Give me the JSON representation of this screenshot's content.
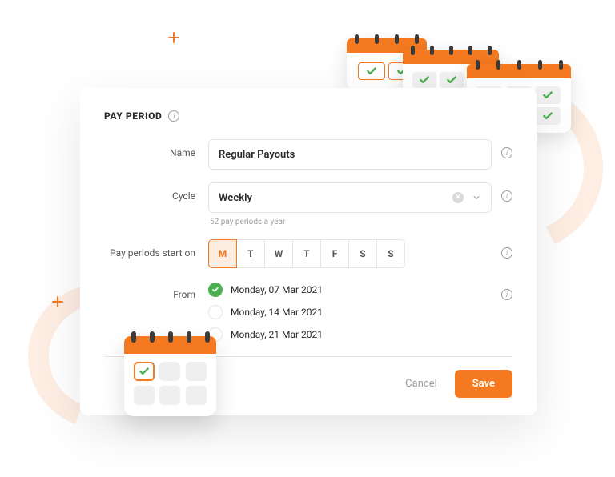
{
  "section_title": "PAY PERIOD",
  "fields": {
    "name": {
      "label": "Name",
      "value": "Regular Payouts"
    },
    "cycle": {
      "label": "Cycle",
      "value": "Weekly",
      "hint": "52 pay periods a year"
    },
    "start_day": {
      "label": "Pay periods start on",
      "days": [
        "M",
        "T",
        "W",
        "T",
        "F",
        "S",
        "S"
      ],
      "selected_index": 0
    },
    "from": {
      "label": "From",
      "options": [
        "Monday, 07 Mar 2021",
        "Monday, 14 Mar 2021",
        "Monday, 21 Mar 2021"
      ],
      "selected_index": 0
    }
  },
  "actions": {
    "cancel": "Cancel",
    "save": "Save"
  }
}
